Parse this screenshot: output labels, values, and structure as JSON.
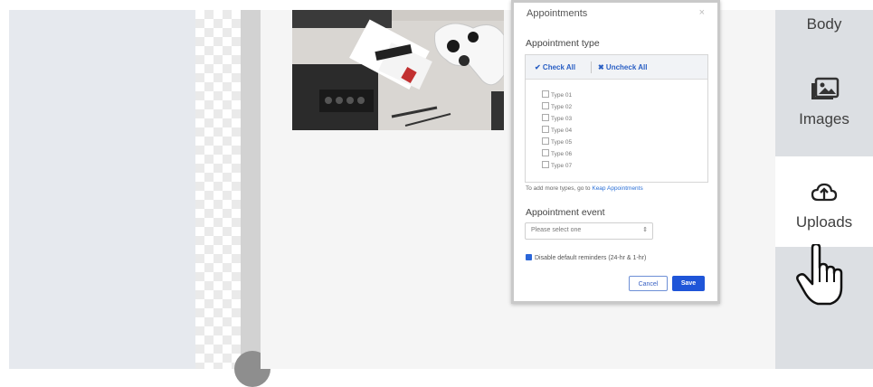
{
  "right_rail": {
    "items": [
      {
        "label": "Body",
        "icon": "body-icon"
      },
      {
        "label": "Images",
        "icon": "images-icon"
      },
      {
        "label": "Uploads",
        "icon": "cloud-upload-icon"
      }
    ]
  },
  "modal": {
    "title": "Appointments",
    "close": "×",
    "appointment_type_label": "Appointment type",
    "check_all": "✔ Check All",
    "uncheck_all": "✖ Uncheck All",
    "types": [
      "Type 01",
      "Type 02",
      "Type 03",
      "Type 04",
      "Type 05",
      "Type 06",
      "Type 07"
    ],
    "hint_prefix": "To add more types, go to ",
    "hint_link": "Keap Appointments",
    "appointment_event_label": "Appointment event",
    "select_placeholder": "Please select one",
    "select_arrow": "⇕",
    "reminder_label": "Disable default reminders (24-hr & 1-hr)",
    "reminder_checked": true,
    "cancel_label": "Cancel",
    "save_label": "Save"
  },
  "colors": {
    "primary": "#1f55d8",
    "link": "#2a6fd6",
    "rail_bg": "#dcdfe3"
  },
  "canvas": {
    "image": "product-photo"
  }
}
